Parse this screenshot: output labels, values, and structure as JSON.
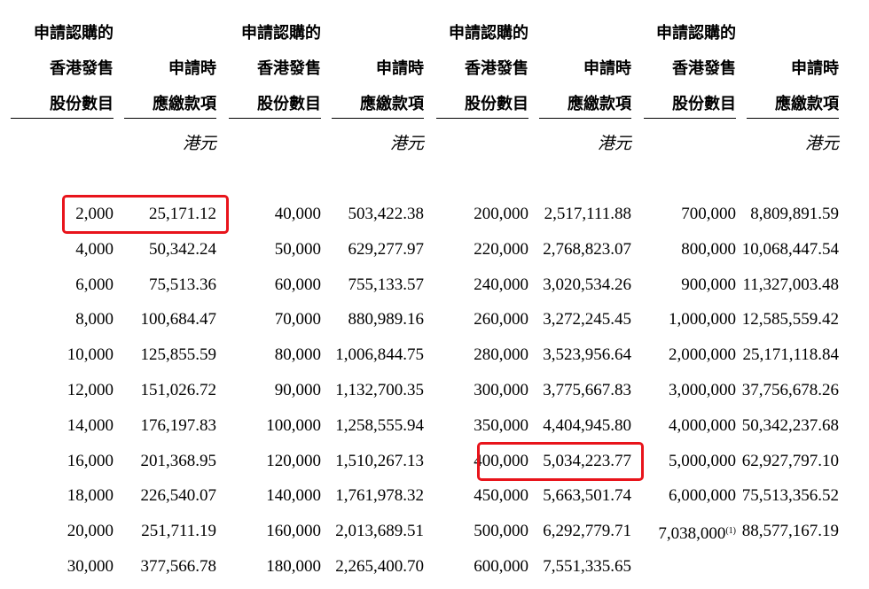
{
  "header": {
    "groups": [
      {
        "shares_lines": [
          "申請認購的",
          "香港發售",
          "股份數目"
        ],
        "amount_lines": [
          "申請時",
          "應繳款項"
        ]
      },
      {
        "shares_lines": [
          "申請認購的",
          "香港發售",
          "股份數目"
        ],
        "amount_lines": [
          "申請時",
          "應繳款項"
        ]
      },
      {
        "shares_lines": [
          "申請認購的",
          "香港發售",
          "股份數目"
        ],
        "amount_lines": [
          "申請時",
          "應繳款項"
        ]
      },
      {
        "shares_lines": [
          "申請認購的",
          "香港發售",
          "股份數目"
        ],
        "amount_lines": [
          "申請時",
          "應繳款項"
        ]
      }
    ],
    "unit": "港元"
  },
  "rows": [
    [
      [
        "2,000",
        "25,171.12"
      ],
      [
        "40,000",
        "503,422.38"
      ],
      [
        "200,000",
        "2,517,111.88"
      ],
      [
        "700,000",
        "8,809,891.59"
      ]
    ],
    [
      [
        "4,000",
        "50,342.24"
      ],
      [
        "50,000",
        "629,277.97"
      ],
      [
        "220,000",
        "2,768,823.07"
      ],
      [
        "800,000",
        "10,068,447.54"
      ]
    ],
    [
      [
        "6,000",
        "75,513.36"
      ],
      [
        "60,000",
        "755,133.57"
      ],
      [
        "240,000",
        "3,020,534.26"
      ],
      [
        "900,000",
        "11,327,003.48"
      ]
    ],
    [
      [
        "8,000",
        "100,684.47"
      ],
      [
        "70,000",
        "880,989.16"
      ],
      [
        "260,000",
        "3,272,245.45"
      ],
      [
        "1,000,000",
        "12,585,559.42"
      ]
    ],
    [
      [
        "10,000",
        "125,855.59"
      ],
      [
        "80,000",
        "1,006,844.75"
      ],
      [
        "280,000",
        "3,523,956.64"
      ],
      [
        "2,000,000",
        "25,171,118.84"
      ]
    ],
    [
      [
        "12,000",
        "151,026.72"
      ],
      [
        "90,000",
        "1,132,700.35"
      ],
      [
        "300,000",
        "3,775,667.83"
      ],
      [
        "3,000,000",
        "37,756,678.26"
      ]
    ],
    [
      [
        "14,000",
        "176,197.83"
      ],
      [
        "100,000",
        "1,258,555.94"
      ],
      [
        "350,000",
        "4,404,945.80"
      ],
      [
        "4,000,000",
        "50,342,237.68"
      ]
    ],
    [
      [
        "16,000",
        "201,368.95"
      ],
      [
        "120,000",
        "1,510,267.13"
      ],
      [
        "400,000",
        "5,034,223.77"
      ],
      [
        "5,000,000",
        "62,927,797.10"
      ]
    ],
    [
      [
        "18,000",
        "226,540.07"
      ],
      [
        "140,000",
        "1,761,978.32"
      ],
      [
        "450,000",
        "5,663,501.74"
      ],
      [
        "6,000,000",
        "75,513,356.52"
      ]
    ],
    [
      [
        "20,000",
        "251,711.19"
      ],
      [
        "160,000",
        "2,013,689.51"
      ],
      [
        "500,000",
        "6,292,779.71"
      ],
      [
        "7,038,000",
        "88,577,167.19"
      ]
    ],
    [
      [
        "30,000",
        "377,566.78"
      ],
      [
        "180,000",
        "2,265,400.70"
      ],
      [
        "600,000",
        "7,551,335.65"
      ],
      [
        "",
        ""
      ]
    ]
  ],
  "footnote_marker": "(1)",
  "highlight_color": "#e8141b",
  "highlights": [
    {
      "row": 0,
      "group": 0
    },
    {
      "row": 7,
      "group": 2
    }
  ]
}
